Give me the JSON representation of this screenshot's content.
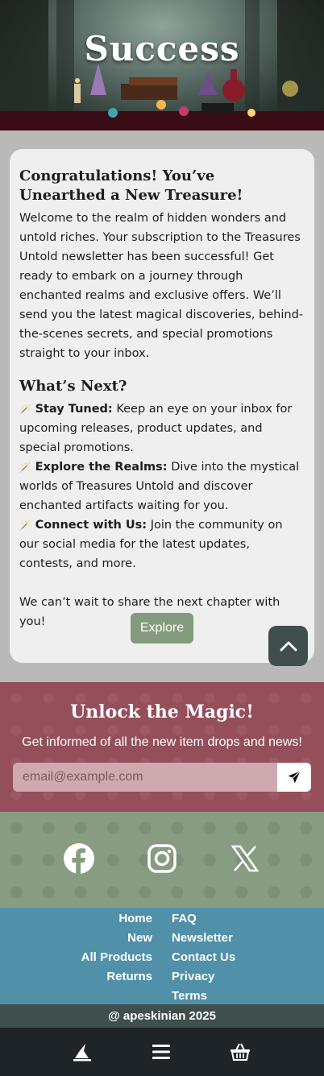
{
  "hero": {
    "title": "Success"
  },
  "card": {
    "heading": "Congratulations! You’ve Unearthed a New Treasure!",
    "intro": "Welcome to the realm of hidden wonders and untold riches. Your subscription to the Treasures Untold newsletter has been successful! Get ready to embark on a journey through enchanted realms and exclusive offers. We’ll send you the latest magical discoveries, behind-the-scenes secrets, and special promotions straight to your inbox.",
    "next_heading": "What’s Next?",
    "next_items": [
      {
        "icon": "wand-icon",
        "title": "Stay Tuned:",
        "text": " Keep an eye on your inbox for upcoming releases, product updates, and special promotions."
      },
      {
        "icon": "wand-icon",
        "title": "Explore the Realms:",
        "text": " Dive into the mystical worlds of Treasures Untold and discover enchanted artifacts waiting for you."
      },
      {
        "icon": "wand-icon",
        "title": "Connect with Us:",
        "text": " Join the community on our social media for the latest updates, contests, and more."
      }
    ],
    "closing": "We can’t wait to share the next chapter with you!",
    "explore_label": "Explore"
  },
  "newsletter": {
    "title": "Unlock the Magic!",
    "subtitle": "Get informed of all the new item drops and news!",
    "email_placeholder": "email@example.com",
    "send_icon": "paper-plane-icon"
  },
  "social": [
    "facebook-icon",
    "instagram-icon",
    "x-icon"
  ],
  "footer_links": {
    "left": [
      "Home",
      "New",
      "All Products",
      "Returns"
    ],
    "right": [
      "FAQ",
      "Newsletter",
      "Contact Us",
      "Privacy",
      "Terms"
    ]
  },
  "copyright": "@ apeskinian 2025",
  "bottom_nav": [
    "wizard-hat-icon",
    "menu-icon",
    "basket-icon"
  ],
  "colors": {
    "newsletter_bg": "#944f5b",
    "social_bg": "#889c82",
    "links_bg": "#5090a8",
    "card_bg": "#efefef",
    "button": "#849a7c",
    "nav_bg": "#1f2428"
  }
}
